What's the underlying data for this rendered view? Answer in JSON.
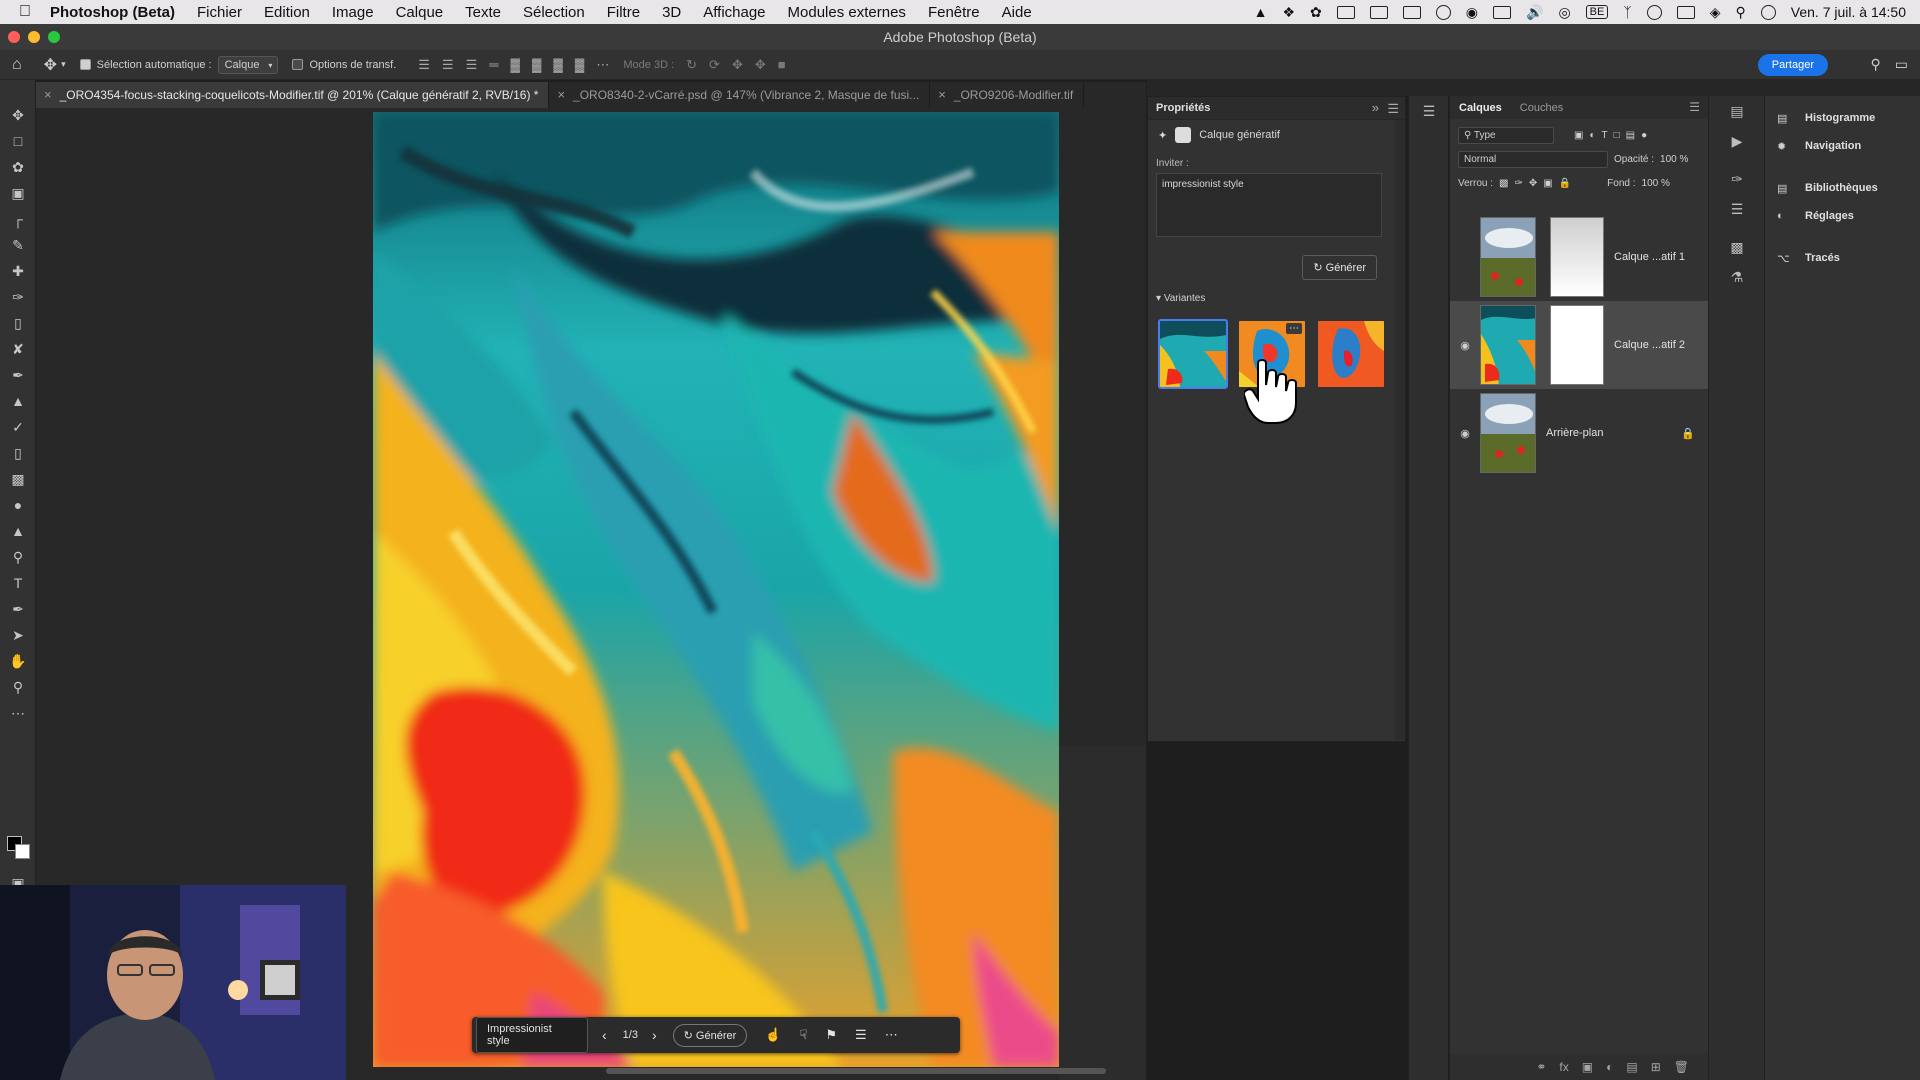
{
  "menubar": {
    "app_name": "Photoshop (Beta)",
    "items": [
      "Fichier",
      "Edition",
      "Image",
      "Calque",
      "Texte",
      "Sélection",
      "Filtre",
      "3D",
      "Affichage",
      "Modules externes",
      "Fenêtre",
      "Aide"
    ],
    "datetime": "Ven. 7 juil. à 14:50",
    "keyboard_badge": "BE"
  },
  "window": {
    "title": "Adobe Photoshop (Beta)"
  },
  "options_bar": {
    "auto_select_label": "Sélection automatique :",
    "auto_select_value": "Calque",
    "transform_label": "Options de transf.",
    "mode3d_label": "Mode 3D :",
    "share_label": "Partager"
  },
  "tabs": [
    {
      "label": "_ORO4354-focus-stacking-coquelicots-Modifier.tif @ 201% (Calque génératif 2, RVB/16) *",
      "active": true
    },
    {
      "label": "_ORO8340-2-vCarré.psd @ 147% (Vibrance 2, Masque de fusi...",
      "active": false
    },
    {
      "label": "_ORO9206-Modifier.tif",
      "active": false
    }
  ],
  "taskbar": {
    "prompt": "Impressionist style",
    "count": "1/3",
    "generate_label": "Générer"
  },
  "properties": {
    "title": "Propriétés",
    "layer_type": "Calque génératif",
    "prompt_label": "Inviter :",
    "prompt_value": "impressionist style",
    "generate_label": "Générer",
    "variants_label": "Variantes"
  },
  "layers": {
    "tabs": [
      "Calques",
      "Couches"
    ],
    "filter_label": "Type",
    "blend_mode": "Normal",
    "opacity_label": "Opacité :",
    "opacity_value": "100 %",
    "lock_label": "Verrou :",
    "fill_label": "Fond :",
    "fill_value": "100 %",
    "items": [
      {
        "name": "Calque ...atif 1",
        "visible": false,
        "selected": false
      },
      {
        "name": "Calque ...atif 2",
        "visible": true,
        "selected": true
      },
      {
        "name": "Arrière-plan",
        "visible": true,
        "selected": false,
        "locked": true
      }
    ]
  },
  "right_panels": {
    "items": [
      "Histogramme",
      "Navigation",
      "Bibliothèques",
      "Réglages",
      "Tracés"
    ]
  },
  "colors": {
    "accent": "#1a73e8",
    "selection": "#4a7cf0"
  }
}
